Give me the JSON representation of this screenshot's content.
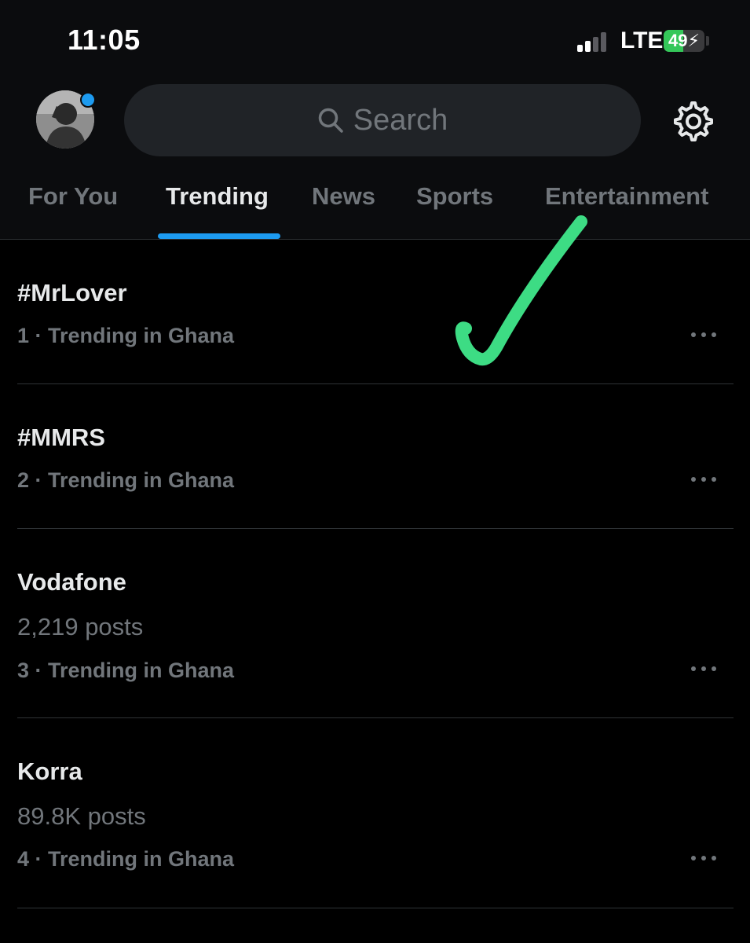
{
  "status_bar": {
    "time": "11:05",
    "network": "LTE",
    "battery_level": 49,
    "battery_label": "49⚡",
    "battery_color": "#34c759"
  },
  "header": {
    "search_placeholder": "Search",
    "avatar_icon": "profile-photo",
    "settings_icon": "gear-icon"
  },
  "tabs": [
    {
      "label": "For You",
      "active": false
    },
    {
      "label": "Trending",
      "active": true
    },
    {
      "label": "News",
      "active": false
    },
    {
      "label": "Sports",
      "active": false
    },
    {
      "label": "Entertainment",
      "active": false
    }
  ],
  "trends": [
    {
      "name": "#MrLover",
      "meta": "1 · Trending in Ghana"
    },
    {
      "name": "#MMRS",
      "meta": "2 · Trending in Ghana"
    },
    {
      "name": "Vodafone",
      "posts": "2,219 posts",
      "meta": "3 · Trending in Ghana"
    },
    {
      "name": "Korra",
      "posts": "89.8K posts",
      "meta": "4 · Trending in Ghana"
    }
  ],
  "colors": {
    "accent": "#1d9bf0",
    "annotation": "#3ddc84",
    "background": "#000000",
    "secondary_text": "#71767b"
  }
}
